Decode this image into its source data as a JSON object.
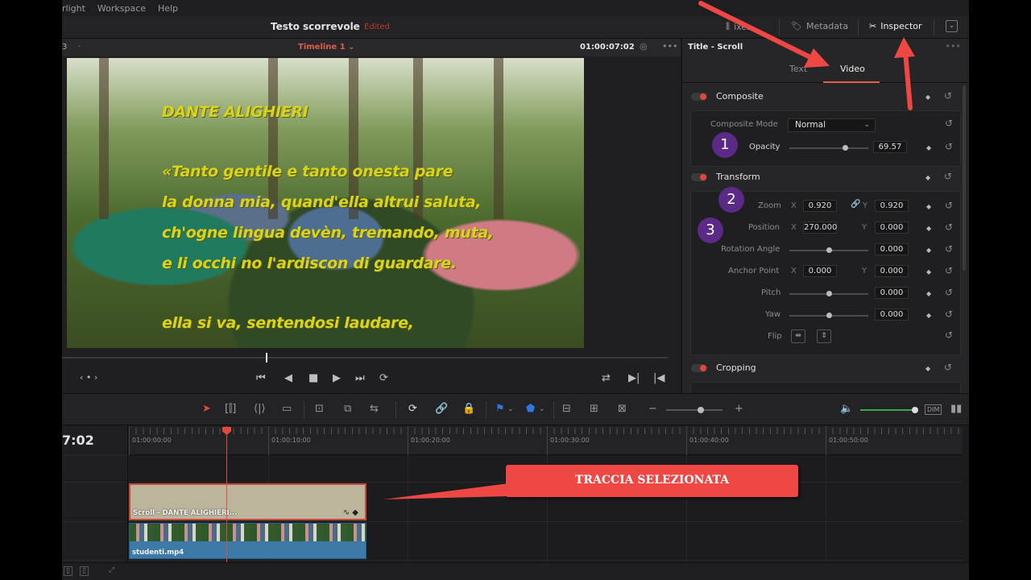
{
  "menu": [
    "rlight",
    "Workspace",
    "Help"
  ],
  "header": {
    "project_title": "Testo scorrevole",
    "edited": "Edited",
    "mixer": "ixer",
    "metadata": "Metadata",
    "inspector": "Inspector"
  },
  "viewer": {
    "left_num": "3",
    "timeline_name": "Timeline 1",
    "timecode": "01:00:07:02",
    "overlay": {
      "title": "DANTE ALIGHIERI",
      "lines": [
        "«Tanto gentile e tanto onesta pare",
        "la donna mia, quand'ella altrui saluta,",
        "ch'ogne lingua devèn, tremando, muta,",
        "e li occhi no l'ardiscon di guardare.",
        "ella si va, sentendosi laudare,"
      ]
    },
    "transport": [
      "⏮",
      "◀",
      "■",
      "▶",
      "⏭",
      "⟳"
    ]
  },
  "inspector": {
    "title": "Title - Scroll",
    "tabs": [
      "Text",
      "Video"
    ],
    "active_tab": "Video",
    "composite": {
      "header": "Composite",
      "mode_label": "Composite Mode",
      "mode_value": "Normal",
      "opacity_label": "Opacity",
      "opacity_value": "69.57",
      "opacity_level": 0.7
    },
    "transform": {
      "header": "Transform",
      "zoom_label": "Zoom",
      "zoom_x": "0.920",
      "zoom_y": "0.920",
      "position_label": "Position",
      "position_x": "270.000",
      "position_y": "0.000",
      "rotation_label": "Rotation Angle",
      "rotation_value": "0.000",
      "anchor_label": "Anchor Point",
      "anchor_x": "0.000",
      "anchor_y": "0.000",
      "pitch_label": "Pitch",
      "pitch_value": "0.000",
      "yaw_label": "Yaw",
      "yaw_value": "0.000",
      "flip_label": "Flip",
      "axis_x": "X",
      "axis_y": "Y"
    },
    "cropping": {
      "header": "Cropping"
    },
    "badges": [
      "1",
      "2",
      "3"
    ]
  },
  "timeline": {
    "timecode": "7:02",
    "ruler": [
      "01:00:00:00",
      "01:00:10:00",
      "01:00:20:00",
      "01:00:30:00",
      "01:00:40:00",
      "01:00:50:00"
    ],
    "title_clip": "Scroll - DANTE ALIGHIERI...",
    "video_clip": "studenti.mp4"
  },
  "toolbar": {
    "dim": "DIM"
  },
  "annotation": {
    "callout": "TRACCIA SELEZIONATA"
  },
  "colors": {
    "accent_red": "#e05e4a",
    "callout_red": "#ef4743",
    "overlay_yellow": "#d8d31c",
    "badge_purple": "#5b2a86",
    "clip_blue": "#3e7aa8"
  }
}
